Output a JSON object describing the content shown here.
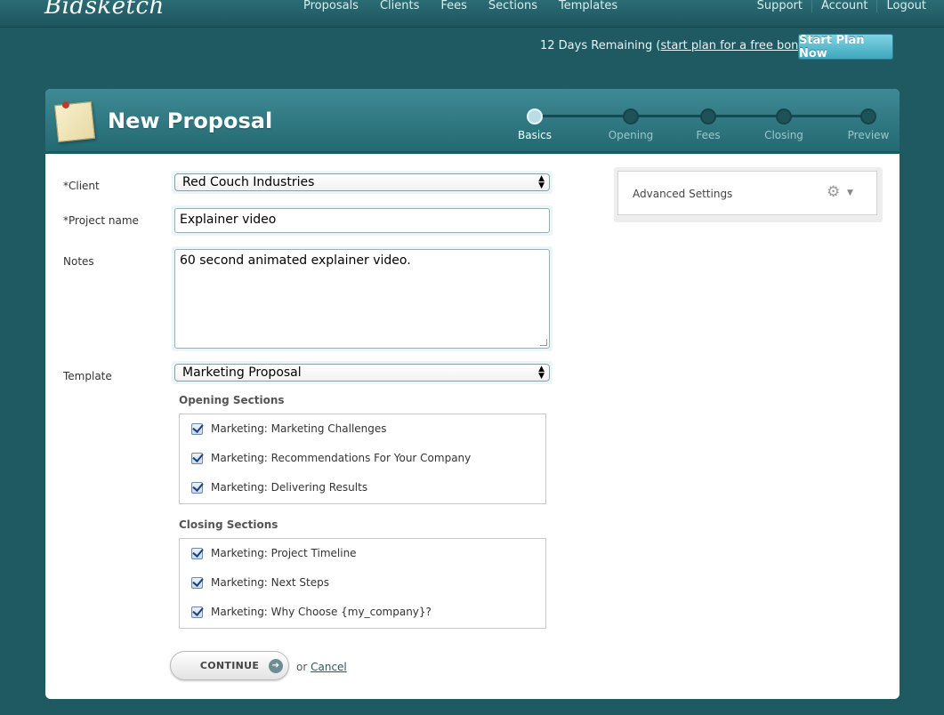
{
  "brand": {
    "logo": "Bidsketch"
  },
  "nav": {
    "main": [
      "Proposals",
      "Clients",
      "Fees",
      "Sections",
      "Templates"
    ],
    "right": [
      "Support",
      "Account",
      "Logout"
    ]
  },
  "trial": {
    "text_before": "12 Days Remaining (",
    "link": "start plan for a free bonus",
    "text_after": ")",
    "button": "Start Plan Now"
  },
  "header": {
    "title": "New Proposal",
    "steps": [
      {
        "label": "Basics",
        "active": true
      },
      {
        "label": "Opening",
        "active": false
      },
      {
        "label": "Fees",
        "active": false
      },
      {
        "label": "Closing",
        "active": false
      },
      {
        "label": "Preview",
        "active": false
      }
    ]
  },
  "form": {
    "client_label": "*Client",
    "client_value": "Red Couch Industries",
    "project_label": "*Project name",
    "project_value": "Explainer video",
    "notes_label": "Notes",
    "notes_value": "60 second animated explainer video.",
    "template_label": "Template",
    "template_value": "Marketing Proposal"
  },
  "opening": {
    "title": "Opening Sections",
    "items": [
      "Marketing: Marketing Challenges",
      "Marketing: Recommendations For Your Company",
      "Marketing: Delivering Results"
    ]
  },
  "closing": {
    "title": "Closing Sections",
    "items": [
      "Marketing: Project Timeline",
      "Marketing: Next Steps",
      "Marketing: Why Choose {my_company}?"
    ]
  },
  "actions": {
    "continue": "CONTINUE",
    "or": "or",
    "cancel": "Cancel"
  },
  "advanced": {
    "label": "Advanced Settings"
  }
}
